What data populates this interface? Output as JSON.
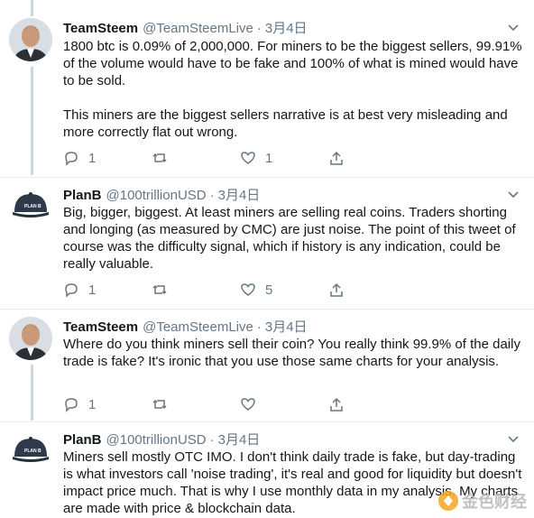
{
  "tweets": [
    {
      "name": "TeamSteem",
      "handle": "@TeamSteemLive",
      "sep": "·",
      "date": "3月4日",
      "avatar_icon": "user-photo-icon",
      "paragraphs": [
        "1800 btc is 0.09% of 2,000,000. For miners to be the biggest sellers, 99.91% of the volume would have to be fake and 100% of what is mined would have to be sold.",
        "This miners are the biggest sellers narrative is at best very misleading and more correctly flat out wrong."
      ],
      "reply_count": "1",
      "retweet_count": "",
      "like_count": "1"
    },
    {
      "name": "PlanB",
      "handle": "@100trillionUSD",
      "sep": "·",
      "date": "3月4日",
      "avatar_icon": "planb-cap-icon",
      "paragraphs": [
        "Big, bigger, biggest. At least miners are selling real coins. Traders shorting and longing (as measured by CMC) are just noise. The point of this tweet of course was the difficulty signal, which if history is any indication, could be really valuable."
      ],
      "reply_count": "1",
      "retweet_count": "",
      "like_count": "5"
    },
    {
      "name": "TeamSteem",
      "handle": "@TeamSteemLive",
      "sep": "·",
      "date": "3月4日",
      "avatar_icon": "user-photo-icon",
      "paragraphs": [
        "Where do you think miners sell their coin? You really think 99.9% of the daily trade is fake? It's ironic that you use those same charts for your analysis."
      ],
      "reply_count": "1",
      "retweet_count": "",
      "like_count": ""
    },
    {
      "name": "PlanB",
      "handle": "@100trillionUSD",
      "sep": "·",
      "date": "3月4日",
      "avatar_icon": "planb-cap-icon",
      "paragraphs": [
        "Miners sell mostly OTC IMO. I don't think daily trade is fake, but day-trading is what investors call 'noise trading', it's real and good for liquidity but doesn't impact price much. That is why I use monthly data in my analysis. My charts are made with price & blockchain data."
      ]
    }
  ],
  "avatar_cap_label": "PLAN B",
  "watermark": {
    "icon": "jinse-logo-icon",
    "text": "金色财经"
  },
  "colors": {
    "text": "#14171a",
    "muted": "#657786",
    "divider": "#e6ecf0",
    "thread_line": "#ccd6dd"
  }
}
